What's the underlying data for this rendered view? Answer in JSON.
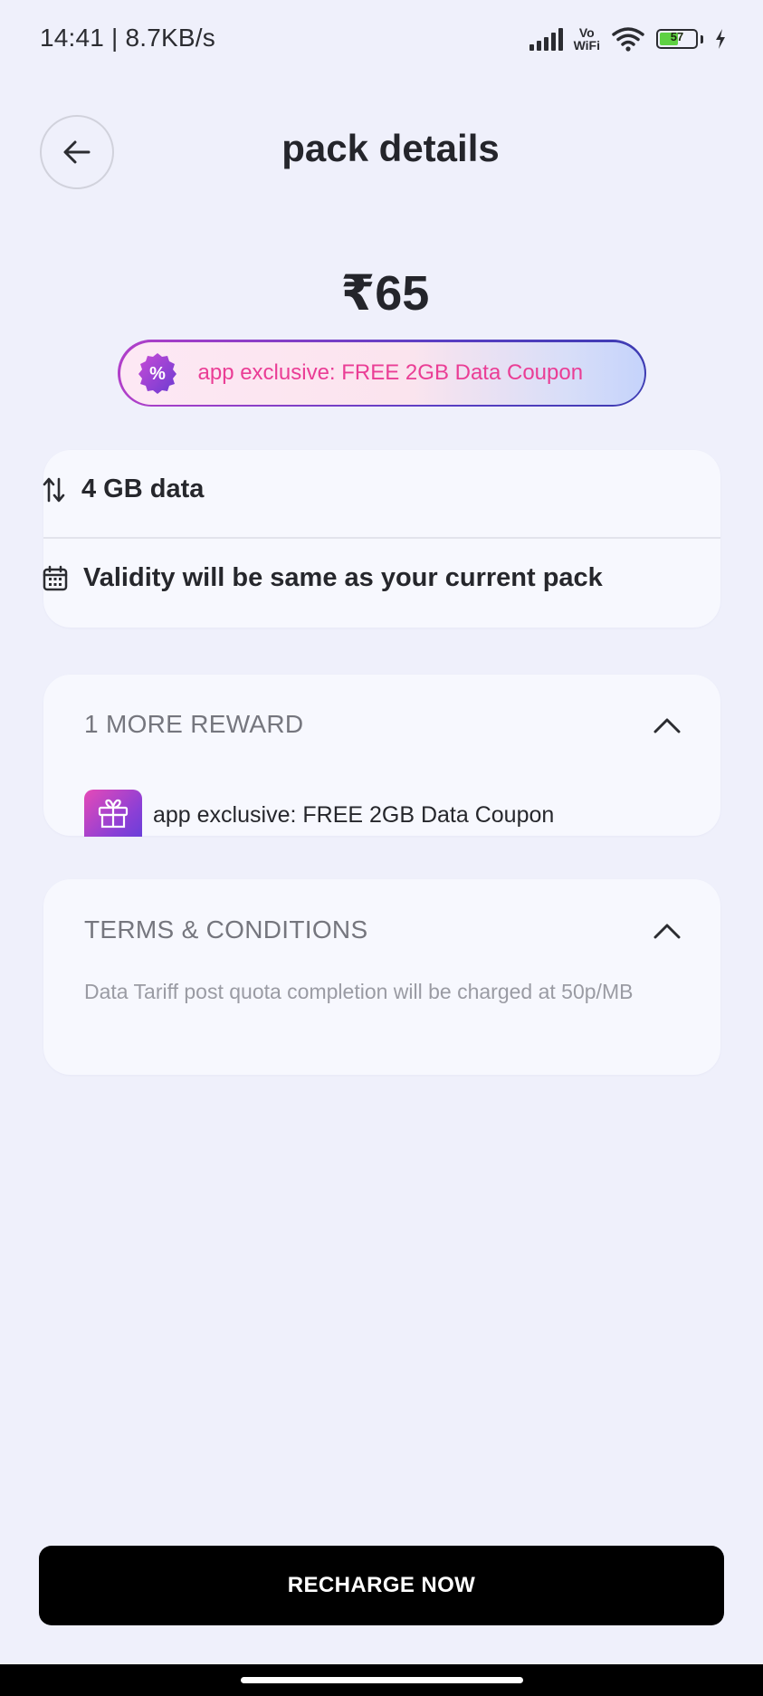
{
  "status_bar": {
    "time": "14:41 | 8.7KB/s",
    "vowifi_top": "Vo",
    "vowifi_bottom": "WiFi",
    "battery": "57",
    "battery_level_percent": 57,
    "icons": [
      "signal-icon",
      "vowifi-icon",
      "wifi-icon",
      "battery-icon",
      "charging-icon"
    ]
  },
  "header": {
    "title": "pack details",
    "back_icon": "arrow-left-icon"
  },
  "price": "₹65",
  "promo": {
    "badge_symbol": "%",
    "text": "app exclusive: FREE 2GB Data Coupon"
  },
  "pack_info": {
    "data": "4 GB data",
    "validity": "Validity will be same as your current pack"
  },
  "rewards": {
    "title": "1 MORE REWARD",
    "item_text": "app exclusive: FREE 2GB Data Coupon"
  },
  "terms": {
    "title": "TERMS & CONDITIONS",
    "text": "Data Tariff post quota completion will be charged at 50p/MB"
  },
  "cta": {
    "label": "RECHARGE NOW"
  },
  "colors": {
    "background": "#eff0fb",
    "card": "#f7f8fe",
    "promo_text": "#ea3d95",
    "button": "#000000"
  }
}
